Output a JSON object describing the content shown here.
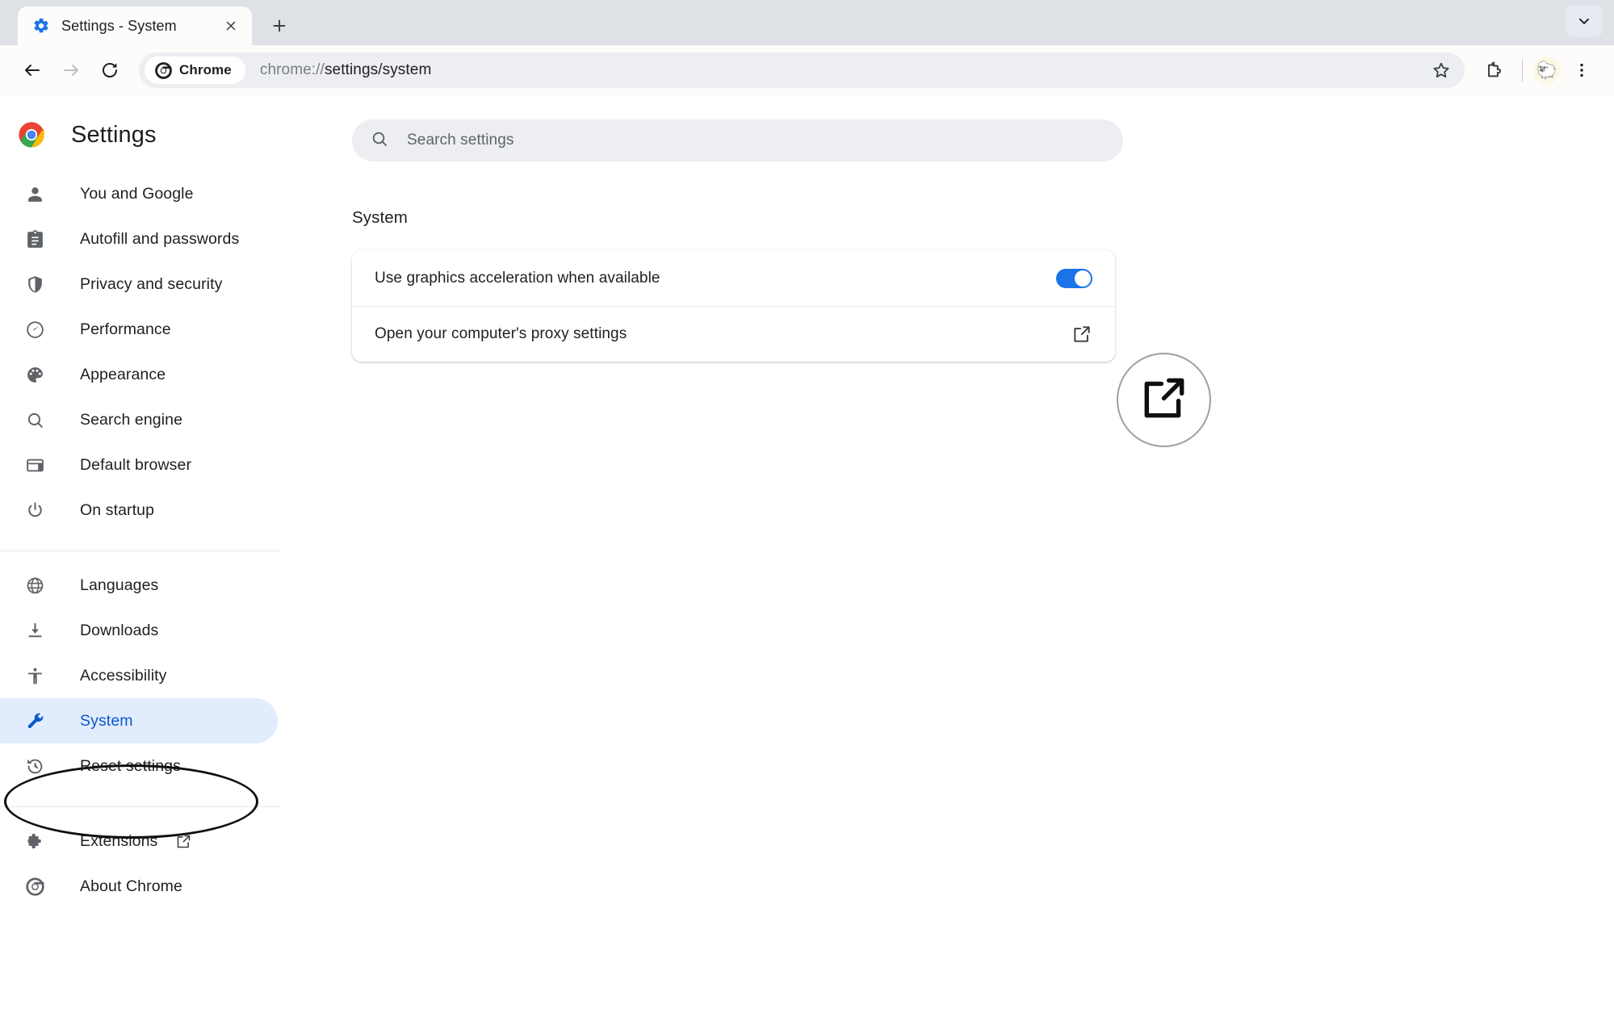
{
  "window": {
    "tab": {
      "title": "Settings - System",
      "favicon": "gear-icon",
      "close_label": "×"
    },
    "new_tab_label": "+",
    "tabstrip_expand": "chevron-down-icon"
  },
  "toolbar": {
    "back": "back-arrow-icon",
    "forward": "forward-arrow-icon",
    "reload": "reload-icon",
    "chrome_chip_label": "Chrome",
    "url_scheme": "chrome://",
    "url_path": "settings/system",
    "url_full": "chrome://settings/system",
    "bookmark": "star-icon",
    "extensions": "puzzle-icon",
    "profile_avatar": "sheep-avatar",
    "menu": "three-dot-menu-icon"
  },
  "sidebar": {
    "brand_title": "Settings",
    "brand_logo": "chrome-logo-icon",
    "groups": [
      {
        "items": [
          {
            "label": "You and Google",
            "icon": "person-icon",
            "active": false
          },
          {
            "label": "Autofill and passwords",
            "icon": "clipboard-icon",
            "active": false
          },
          {
            "label": "Privacy and security",
            "icon": "shield-icon",
            "active": false
          },
          {
            "label": "Performance",
            "icon": "speedometer-icon",
            "active": false
          },
          {
            "label": "Appearance",
            "icon": "palette-icon",
            "active": false
          },
          {
            "label": "Search engine",
            "icon": "search-icon",
            "active": false
          },
          {
            "label": "Default browser",
            "icon": "browser-window-icon",
            "active": false
          },
          {
            "label": "On startup",
            "icon": "power-icon",
            "active": false
          }
        ]
      },
      {
        "items": [
          {
            "label": "Languages",
            "icon": "globe-icon",
            "active": false
          },
          {
            "label": "Downloads",
            "icon": "download-icon",
            "active": false
          },
          {
            "label": "Accessibility",
            "icon": "accessibility-icon",
            "active": false
          },
          {
            "label": "System",
            "icon": "wrench-icon",
            "active": true
          },
          {
            "label": "Reset settings",
            "icon": "history-icon",
            "active": false
          }
        ]
      },
      {
        "items": [
          {
            "label": "Extensions",
            "icon": "puzzle-icon",
            "active": false,
            "external": true
          },
          {
            "label": "About Chrome",
            "icon": "chrome-icon",
            "active": false,
            "external": false
          }
        ]
      }
    ]
  },
  "search": {
    "placeholder": "Search settings",
    "value": "",
    "icon": "search-icon"
  },
  "main": {
    "section_title": "System",
    "rows": [
      {
        "label": "Use graphics acceleration when available",
        "control": "toggle",
        "toggle_on": true
      },
      {
        "label": "Open your computer's proxy settings",
        "control": "external-link",
        "icon": "external-link-icon"
      }
    ]
  },
  "annotations": {
    "sidebar_ellipse": "hand-drawn-ellipse-around-system",
    "magnifier": "magnified-external-link-icon"
  },
  "colors": {
    "accent_blue": "#0b57d0",
    "toggle_on": "#1a73e8",
    "active_pill": "#e1ecfd",
    "tabstrip_bg": "#dee1e6",
    "toolbar_bg": "#fdfcfb",
    "omnibox_bg": "#eceef1",
    "text_primary": "#1f1f1f",
    "text_secondary": "#5f6368",
    "annotation_stroke": "#101010"
  }
}
